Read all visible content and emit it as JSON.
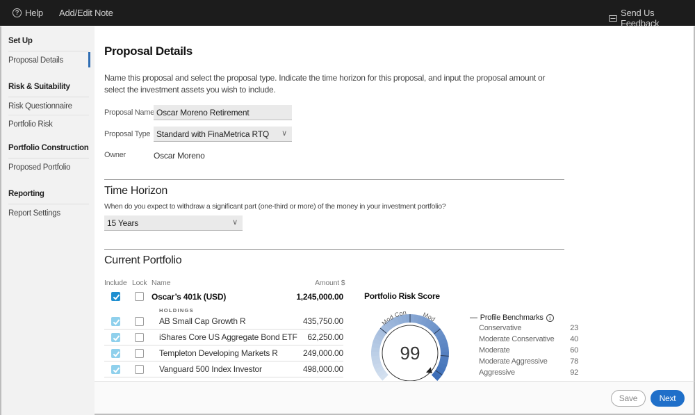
{
  "topbar": {
    "help_label": "Help",
    "add_note_label": "Add/Edit Note",
    "feedback_label": "Send Us Feedback"
  },
  "sidebar": {
    "sections": [
      {
        "title": "Set Up",
        "items": [
          {
            "label": "Proposal Details",
            "active": true
          }
        ]
      },
      {
        "title": "Risk & Suitability",
        "items": [
          {
            "label": "Risk Questionnaire"
          },
          {
            "label": "Portfolio Risk"
          }
        ]
      },
      {
        "title": "Portfolio Construction",
        "items": [
          {
            "label": "Proposed Portfolio"
          }
        ]
      },
      {
        "title": "Reporting",
        "items": [
          {
            "label": "Report Settings"
          }
        ]
      }
    ]
  },
  "main": {
    "title": "Proposal Details",
    "intro": "Name this proposal and select the proposal type. Indicate the time horizon for this proposal, and input the proposal amount or select the investment assets you wish to include.",
    "proposal_name_label": "Proposal Name",
    "proposal_name_value": "Oscar Moreno Retirement",
    "proposal_type_label": "Proposal Type",
    "proposal_type_value": "Standard with FinaMetrica RTQ",
    "owner_label": "Owner",
    "owner_value": "Oscar Moreno",
    "time_horizon": {
      "title": "Time Horizon",
      "question": "When do you expect to withdraw a significant part (one-third or more) of the money in your investment portfolio?",
      "selected": "15 Years"
    },
    "current_portfolio": {
      "title": "Current Portfolio",
      "columns": {
        "include": "Include",
        "lock": "Lock",
        "name": "Name",
        "amount": "Amount $"
      },
      "account": {
        "name": "Oscar’s 401k (USD)",
        "amount": "1,245,000.00",
        "include": true,
        "lock": false
      },
      "holdings_label": "HOLDINGS",
      "holdings": [
        {
          "name": "AB Small Cap Growth R",
          "amount": "435,750.00",
          "include": true,
          "lock": false
        },
        {
          "name": "iShares Core US Aggregate Bond ETF",
          "amount": "62,250.00",
          "include": true,
          "lock": false
        },
        {
          "name": "Templeton Developing Markets R",
          "amount": "249,000.00",
          "include": true,
          "lock": false
        },
        {
          "name": "Vanguard 500 Index Investor",
          "amount": "498,000.00",
          "include": true,
          "lock": false
        }
      ]
    },
    "risk_score": {
      "title": "Portfolio Risk Score",
      "score": "99",
      "score_value": 99,
      "gauge_labels": [
        "Mod Con",
        "Mod"
      ],
      "colors": {
        "light": "#c9d8ec",
        "dark": "#3e6fb8"
      }
    },
    "benchmarks": {
      "title": "Profile Benchmarks",
      "items": [
        {
          "label": "Conservative",
          "value": "23"
        },
        {
          "label": "Moderate Conservative",
          "value": "40"
        },
        {
          "label": "Moderate",
          "value": "60"
        },
        {
          "label": "Moderate Aggressive",
          "value": "78"
        },
        {
          "label": "Aggressive",
          "value": "92"
        }
      ]
    }
  },
  "footer": {
    "save_label": "Save",
    "next_label": "Next"
  }
}
